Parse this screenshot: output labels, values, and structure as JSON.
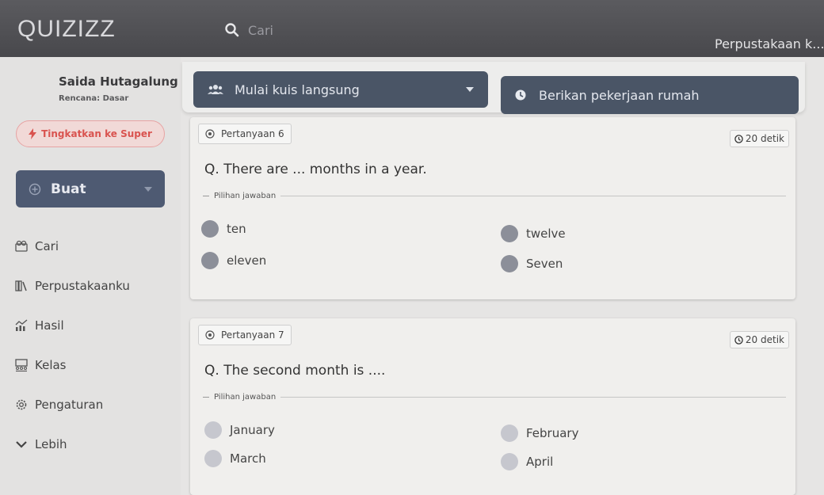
{
  "header": {
    "logo": "QUIZIZZ",
    "search_placeholder": "Cari",
    "library_link": "Perpustakaan k..."
  },
  "sidebar": {
    "user_name": "Saida Hutagalung",
    "plan": "Rencana: Dasar",
    "upgrade_label": "Tingkatkan ke Super",
    "create_label": "Buat",
    "items": [
      {
        "label": "Cari",
        "icon": "search-icon"
      },
      {
        "label": "Perpustakaanku",
        "icon": "library-icon"
      },
      {
        "label": "Hasil",
        "icon": "chart-icon"
      },
      {
        "label": "Kelas",
        "icon": "classroom-icon"
      },
      {
        "label": "Pengaturan",
        "icon": "gear-icon"
      },
      {
        "label": "Lebih",
        "icon": "chevron-down-icon"
      }
    ]
  },
  "actions": {
    "live_label": "Mulai kuis langsung",
    "homework_label": "Berikan pekerjaan rumah"
  },
  "questions": [
    {
      "badge": "Pertanyaan 6",
      "time": "20 detik",
      "text": "Q. There are ... months in a year.",
      "choices_label": "Pilihan jawaban",
      "choices": [
        "ten",
        "twelve",
        "eleven",
        "Seven"
      ]
    },
    {
      "badge": "Pertanyaan 7",
      "time": "20 detik",
      "text": "Q. The second month is ....",
      "choices_label": "Pilihan jawaban",
      "choices": [
        "January",
        "February",
        "March",
        "April"
      ]
    }
  ],
  "colors": {
    "topbar": "#4f4f53",
    "primary_button": "#4a5566",
    "upgrade_text": "#d9534f",
    "upgrade_bg": "#f1d9d7"
  }
}
